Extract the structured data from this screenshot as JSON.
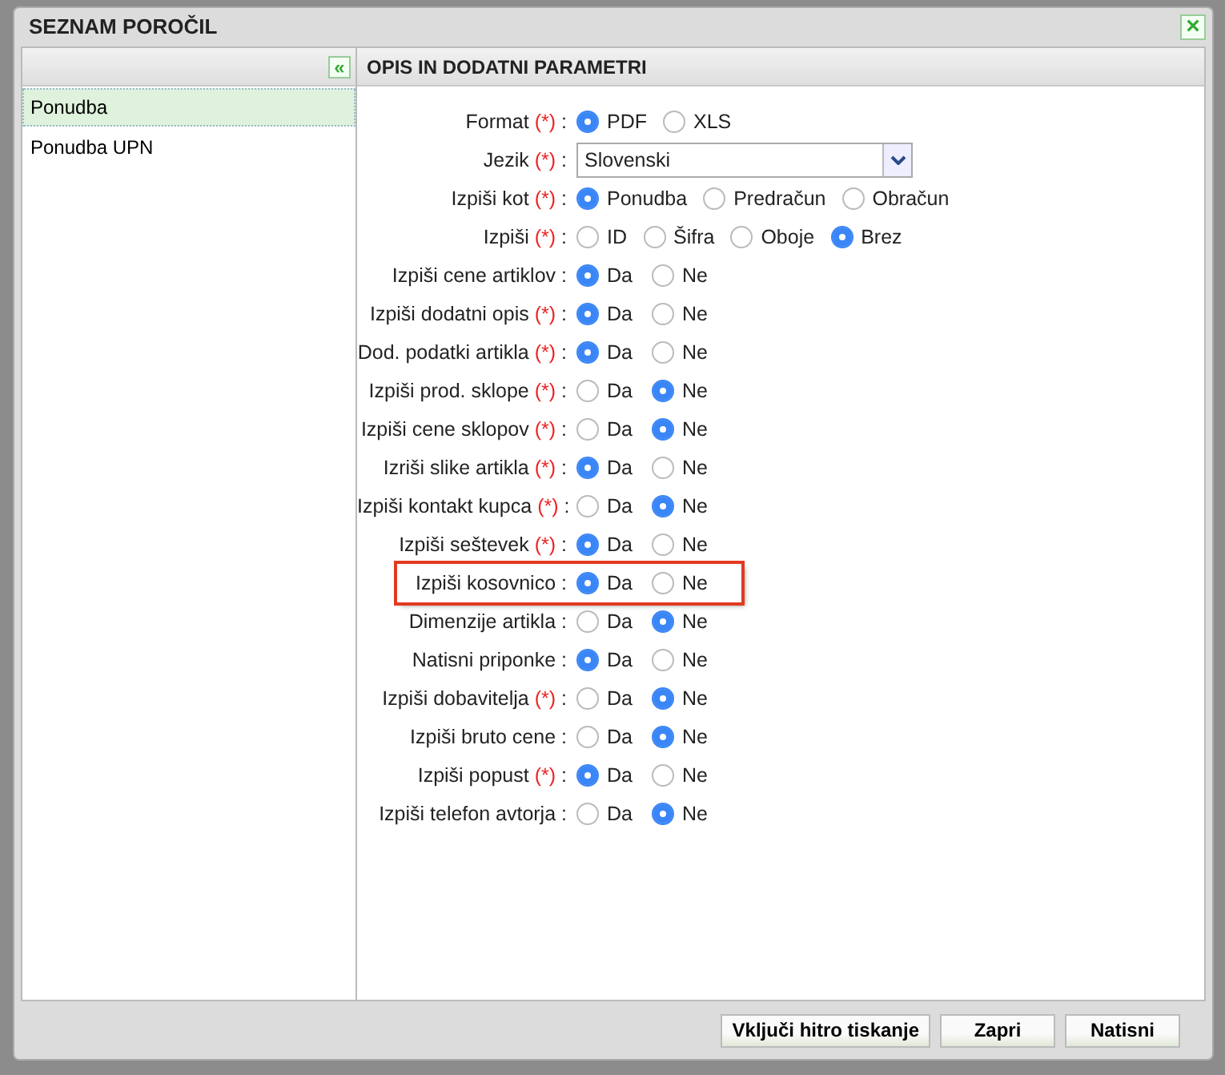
{
  "dialog": {
    "title": "SEZNAM POROČIL",
    "close": "×"
  },
  "reports": {
    "collapse": "«",
    "items": [
      {
        "label": "Ponudba",
        "selected": true
      },
      {
        "label": "Ponudba UPN",
        "selected": false
      }
    ]
  },
  "params": {
    "title": "OPIS IN DODATNI PARAMETRI",
    "required_mark": "(*)",
    "separator": ":",
    "fields": [
      {
        "kind": "radio",
        "label": "Format",
        "required": true,
        "options": [
          {
            "label": "PDF",
            "selected": true
          },
          {
            "label": "XLS",
            "selected": false
          }
        ]
      },
      {
        "kind": "select",
        "label": "Jezik",
        "required": true,
        "value": "Slovenski"
      },
      {
        "kind": "radio",
        "label": "Izpiši kot",
        "required": true,
        "options": [
          {
            "label": "Ponudba",
            "selected": true
          },
          {
            "label": "Predračun",
            "selected": false
          },
          {
            "label": "Obračun",
            "selected": false
          }
        ]
      },
      {
        "kind": "radio",
        "label": "Izpiši",
        "required": true,
        "options": [
          {
            "label": "ID",
            "selected": false
          },
          {
            "label": "Šifra",
            "selected": false
          },
          {
            "label": "Oboje",
            "selected": false
          },
          {
            "label": "Brez",
            "selected": true
          }
        ]
      },
      {
        "kind": "yesno",
        "label": "Izpiši cene artiklov",
        "required": false,
        "options": [
          {
            "label": "Da",
            "selected": true
          },
          {
            "label": "Ne",
            "selected": false
          }
        ]
      },
      {
        "kind": "yesno",
        "label": "Izpiši dodatni opis",
        "required": true,
        "options": [
          {
            "label": "Da",
            "selected": true
          },
          {
            "label": "Ne",
            "selected": false
          }
        ]
      },
      {
        "kind": "yesno",
        "label": "Dod. podatki artikla",
        "required": true,
        "options": [
          {
            "label": "Da",
            "selected": true
          },
          {
            "label": "Ne",
            "selected": false
          }
        ]
      },
      {
        "kind": "yesno",
        "label": "Izpiši prod. sklope",
        "required": true,
        "options": [
          {
            "label": "Da",
            "selected": false
          },
          {
            "label": "Ne",
            "selected": true
          }
        ]
      },
      {
        "kind": "yesno",
        "label": "Izpiši cene sklopov",
        "required": true,
        "options": [
          {
            "label": "Da",
            "selected": false
          },
          {
            "label": "Ne",
            "selected": true
          }
        ]
      },
      {
        "kind": "yesno",
        "label": "Izriši slike artikla",
        "required": true,
        "options": [
          {
            "label": "Da",
            "selected": true
          },
          {
            "label": "Ne",
            "selected": false
          }
        ]
      },
      {
        "kind": "yesno",
        "label": "Izpiši kontakt kupca",
        "required": true,
        "options": [
          {
            "label": "Da",
            "selected": false
          },
          {
            "label": "Ne",
            "selected": true
          }
        ]
      },
      {
        "kind": "yesno",
        "label": "Izpiši seštevek",
        "required": true,
        "options": [
          {
            "label": "Da",
            "selected": true
          },
          {
            "label": "Ne",
            "selected": false
          }
        ]
      },
      {
        "kind": "yesno",
        "label": "Izpiši kosovnico",
        "required": false,
        "highlighted": true,
        "options": [
          {
            "label": "Da",
            "selected": true
          },
          {
            "label": "Ne",
            "selected": false
          }
        ]
      },
      {
        "kind": "yesno",
        "label": "Dimenzije artikla",
        "required": false,
        "options": [
          {
            "label": "Da",
            "selected": false
          },
          {
            "label": "Ne",
            "selected": true
          }
        ]
      },
      {
        "kind": "yesno",
        "label": "Natisni priponke",
        "required": false,
        "options": [
          {
            "label": "Da",
            "selected": true
          },
          {
            "label": "Ne",
            "selected": false
          }
        ]
      },
      {
        "kind": "yesno",
        "label": "Izpiši dobavitelja",
        "required": true,
        "options": [
          {
            "label": "Da",
            "selected": false
          },
          {
            "label": "Ne",
            "selected": true
          }
        ]
      },
      {
        "kind": "yesno",
        "label": "Izpiši bruto cene",
        "required": false,
        "options": [
          {
            "label": "Da",
            "selected": false
          },
          {
            "label": "Ne",
            "selected": true
          }
        ]
      },
      {
        "kind": "yesno",
        "label": "Izpiši popust",
        "required": true,
        "options": [
          {
            "label": "Da",
            "selected": true
          },
          {
            "label": "Ne",
            "selected": false
          }
        ]
      },
      {
        "kind": "yesno",
        "label": "Izpiši telefon avtorja",
        "required": false,
        "options": [
          {
            "label": "Da",
            "selected": false
          },
          {
            "label": "Ne",
            "selected": true
          }
        ]
      }
    ]
  },
  "buttons": [
    "Vključi hitro tiskanje",
    "Zapri",
    "Natisni"
  ]
}
